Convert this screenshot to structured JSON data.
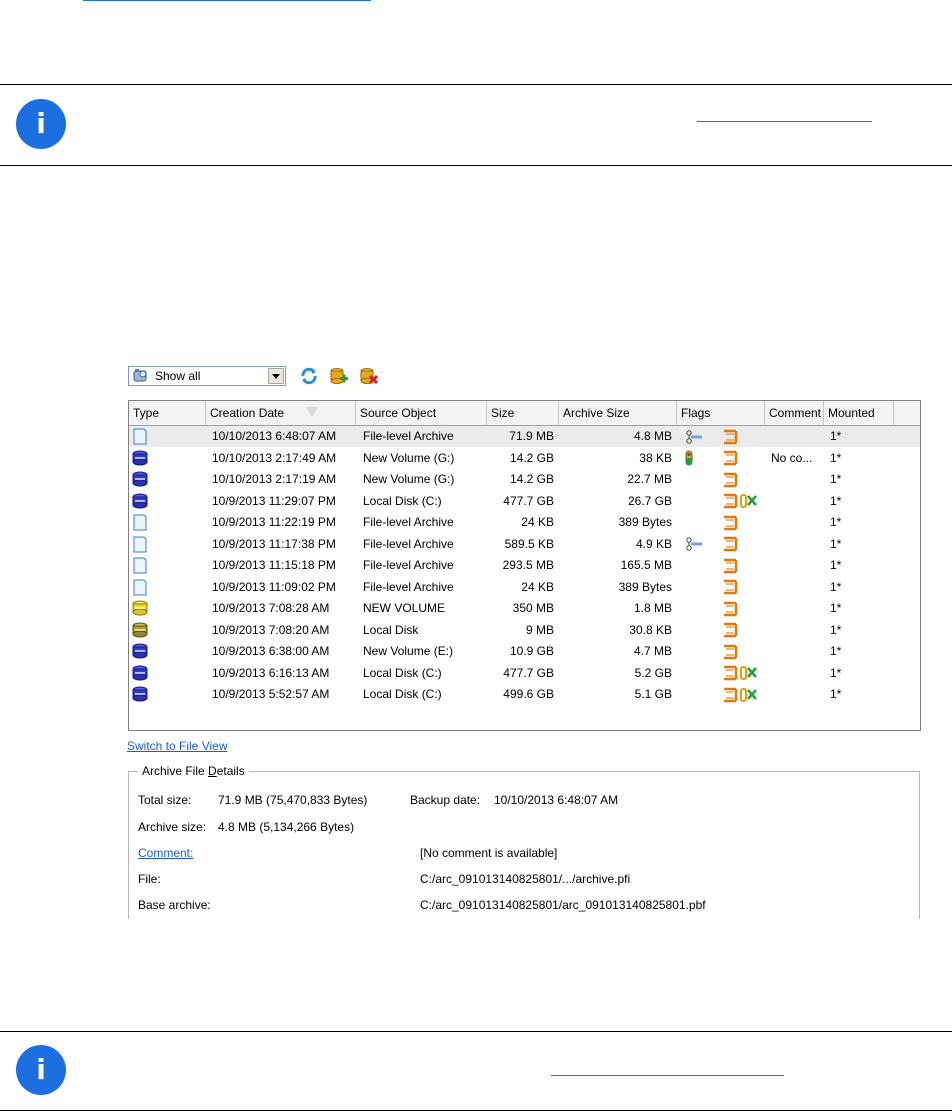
{
  "top_link": {
    "text": ""
  },
  "note1": {
    "link_text": ""
  },
  "note2": {
    "link_text": ""
  },
  "toolbar": {
    "filter_value": "Show all",
    "icons": [
      "refresh-icon",
      "add-archive-icon",
      "delete-archive-icon"
    ]
  },
  "table": {
    "columns": [
      "Type",
      "Creation Date",
      "Source Object",
      "Size",
      "Archive Size",
      "Flags",
      "Comment",
      "Mounted"
    ],
    "rows": [
      {
        "type": "file",
        "date": "10/10/2013 6:48:07 AM",
        "source": "File-level Archive",
        "size": "71.9 MB",
        "archive_size": "4.8 MB",
        "flags": [
          "link",
          "orange"
        ],
        "comment": "",
        "mounted": "1*"
      },
      {
        "type": "disk-blue",
        "date": "10/10/2013 2:17:49 AM",
        "source": "New Volume (G:)",
        "size": "14.2 GB",
        "archive_size": "38 KB",
        "flags": [
          "capsule",
          "orange"
        ],
        "comment": "No co...",
        "mounted": "1*"
      },
      {
        "type": "disk-blue",
        "date": "10/10/2013 2:17:19 AM",
        "source": "New Volume (G:)",
        "size": "14.2 GB",
        "archive_size": "22.7 MB",
        "flags": [
          "orange"
        ],
        "comment": "",
        "mounted": "1*"
      },
      {
        "type": "disk-blue",
        "date": "10/9/2013 11:29:07 PM",
        "source": "Local Disk (C:)",
        "size": "477.7 GB",
        "archive_size": "26.7 GB",
        "flags": [
          "orange",
          "green"
        ],
        "comment": "",
        "mounted": "1*"
      },
      {
        "type": "file",
        "date": "10/9/2013 11:22:19 PM",
        "source": "File-level Archive",
        "size": "24 KB",
        "archive_size": "389 Bytes",
        "flags": [
          "orange"
        ],
        "comment": "",
        "mounted": "1*"
      },
      {
        "type": "file",
        "date": "10/9/2013 11:17:38 PM",
        "source": "File-level Archive",
        "size": "589.5 KB",
        "archive_size": "4.9 KB",
        "flags": [
          "link",
          "orange"
        ],
        "comment": "",
        "mounted": "1*"
      },
      {
        "type": "file",
        "date": "10/9/2013 11:15:18 PM",
        "source": "File-level Archive",
        "size": "293.5 MB",
        "archive_size": "165.5 MB",
        "flags": [
          "orange"
        ],
        "comment": "",
        "mounted": "1*"
      },
      {
        "type": "file",
        "date": "10/9/2013 11:09:02 PM",
        "source": "File-level Archive",
        "size": "24 KB",
        "archive_size": "389 Bytes",
        "flags": [
          "orange"
        ],
        "comment": "",
        "mounted": "1*"
      },
      {
        "type": "disk-yellow",
        "date": "10/9/2013 7:08:28 AM",
        "source": "NEW VOLUME",
        "size": "350 MB",
        "archive_size": "1.8 MB",
        "flags": [
          "orange"
        ],
        "comment": "",
        "mounted": "1*"
      },
      {
        "type": "disk-olive",
        "date": "10/9/2013 7:08:20 AM",
        "source": "Local Disk",
        "size": "9 MB",
        "archive_size": "30.8 KB",
        "flags": [
          "orange"
        ],
        "comment": "",
        "mounted": "1*"
      },
      {
        "type": "disk-blue",
        "date": "10/9/2013 6:38:00 AM",
        "source": "New Volume (E:)",
        "size": "10.9 GB",
        "archive_size": "4.7 MB",
        "flags": [
          "orange"
        ],
        "comment": "",
        "mounted": "1*"
      },
      {
        "type": "disk-blue",
        "date": "10/9/2013 6:16:13 AM",
        "source": "Local Disk (C:)",
        "size": "477.7 GB",
        "archive_size": "5.2 GB",
        "flags": [
          "orange",
          "green"
        ],
        "comment": "",
        "mounted": "1*"
      },
      {
        "type": "disk-blue",
        "date": "10/9/2013 5:52:57 AM",
        "source": "Local Disk (C:)",
        "size": "499.6 GB",
        "archive_size": "5.1 GB",
        "flags": [
          "orange",
          "green"
        ],
        "comment": "",
        "mounted": "1*"
      }
    ]
  },
  "switch_link": "Switch to File View",
  "details": {
    "legend": "Archive File Details",
    "total_size_label": "Total size:",
    "total_size_value": "71.9 MB (75,470,833 Bytes)",
    "backup_date_label": "Backup date:",
    "backup_date_value": "10/10/2013 6:48:07 AM",
    "archive_size_label": "Archive size:",
    "archive_size_value": "4.8 MB (5,134,266 Bytes)",
    "comment_label": "Comment:",
    "comment_value": "[No comment is available]",
    "file_label": "File:",
    "file_value": "C:/arc_091013140825801/.../archive.pfi",
    "base_label": "Base archive:",
    "base_value": "C:/arc_091013140825801/arc_091013140825801.pbf"
  }
}
